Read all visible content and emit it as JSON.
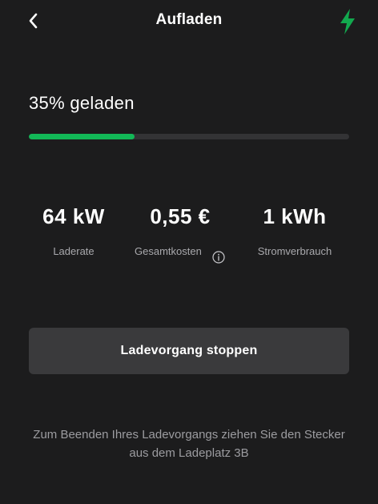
{
  "header": {
    "title": "Aufladen",
    "back_icon": "chevron-left-icon",
    "status_icon": "lightning-bolt-icon"
  },
  "charge": {
    "percent_text": "35% geladen",
    "progress_fraction": 0.33
  },
  "stats": [
    {
      "value": "64 kW",
      "label": "Laderate"
    },
    {
      "value": "0,55 €",
      "label": "Gesamtkosten",
      "info_icon": "info-icon"
    },
    {
      "value": "1 kWh",
      "label": "Stromverbrauch"
    }
  ],
  "actions": {
    "stop_label": "Ladevorgang stoppen"
  },
  "hint": "Zum Beenden Ihres Ladevorgangs ziehen Sie den Stecker aus dem Ladeplatz 3B",
  "colors": {
    "background": "#1c1c1d",
    "accent": "#12b857",
    "button": "#3a3a3c",
    "muted_text": "#a9a9ad"
  }
}
